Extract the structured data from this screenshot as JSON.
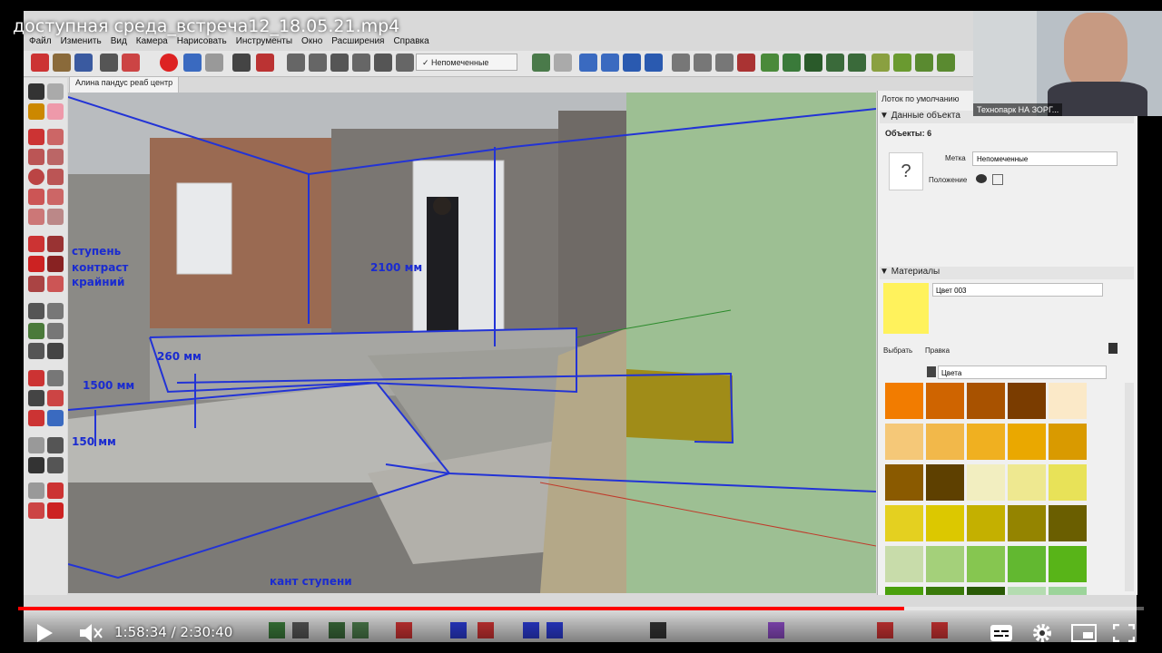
{
  "video": {
    "title": "доступная среда_встреча12_18.05.21.mp4",
    "time": "1:58:34 / 2:30:40",
    "progress_fraction": 0.787
  },
  "menu": [
    "Файл",
    "Изменить",
    "Вид",
    "Камера",
    "Нарисовать",
    "Инструменты",
    "Окно",
    "Расширения",
    "Справка"
  ],
  "toolbar": {
    "tag_select_value": "Непомеченные"
  },
  "scene_tab": "Алина пандус реаб центр",
  "annotations": {
    "height_2100": "2100 мм",
    "height_260": "260 мм",
    "dim_1500": "1500 мм",
    "dim_150": "150 мм",
    "label_steps": "ступень",
    "label_contrast": "контраст",
    "label_edge": "крайний",
    "label_kant": "кант ступени"
  },
  "panel": {
    "default_tray": "Лоток по умолчанию",
    "entity_info_header": "Данные объекта",
    "objects_count": "Объекты: 6",
    "tag_label": "Метка",
    "tag_value": "Непомеченные",
    "layout_label": "Положение",
    "placeholder_glyph": "?",
    "materials_header": "Материалы",
    "material_name": "Цвет 003",
    "tab_select": "Выбрать",
    "tab_edit": "Правка",
    "library_value": "Цвета",
    "current_color": "#fff25c",
    "swatches": [
      "#f27c00",
      "#cf6400",
      "#a85200",
      "#7a3c00",
      "#fbe9c8",
      "#f5c878",
      "#f2b84a",
      "#f0b020",
      "#eaa800",
      "#d99a00",
      "#8a5a00",
      "#5e4000",
      "#f2eec0",
      "#eee890",
      "#e8e258",
      "#e4d020",
      "#dcc800",
      "#c4b000",
      "#948400",
      "#6a5e00",
      "#c8dcaa",
      "#a4d07a",
      "#86c650",
      "#62b830",
      "#58b418",
      "#4aa00c",
      "#3a7a0a",
      "#2a5a06",
      "#b4dcb0",
      "#9cd49a"
    ]
  },
  "webcam": {
    "label": "Технопарк НА ЗОРГ..."
  }
}
